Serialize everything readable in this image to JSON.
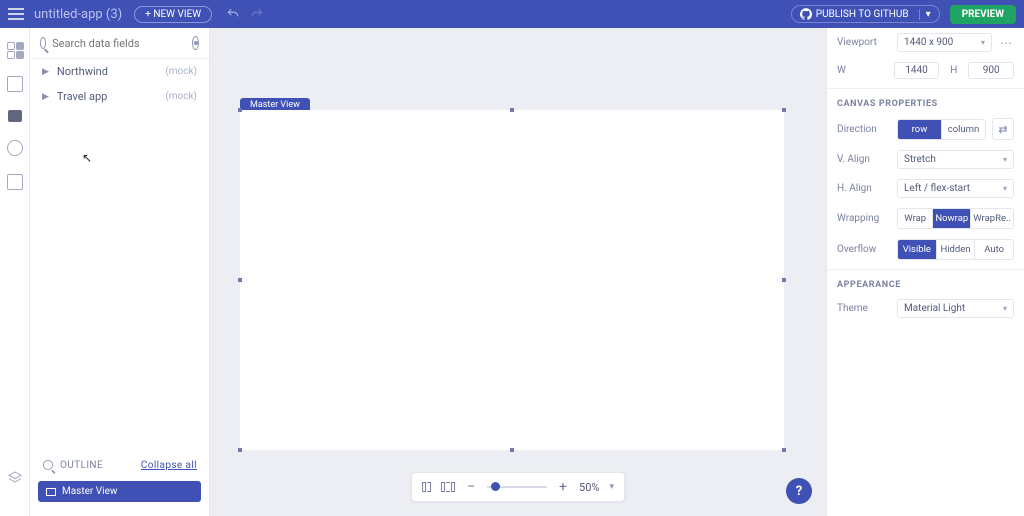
{
  "header": {
    "app_name": "untitled-app (3)",
    "new_view_label": "+ NEW VIEW",
    "publish_label": "PUBLISH TO GITHUB",
    "preview_label": "PREVIEW"
  },
  "left": {
    "search_placeholder": "Search data fields",
    "datasources": [
      {
        "name": "Northwind",
        "tag": "(mock)"
      },
      {
        "name": "Travel app",
        "tag": "(mock)"
      }
    ],
    "outline_label": "OUTLINE",
    "collapse_label": "Collapse all",
    "master_view_label": "Master View"
  },
  "canvas": {
    "view_label": "Master View",
    "zoom_pct": "50%"
  },
  "props": {
    "viewport": {
      "label": "Viewport",
      "value": "1440 x 900"
    },
    "width": {
      "label": "W",
      "value": "1440"
    },
    "height": {
      "label": "H",
      "value": "900"
    },
    "section_canvas": "CANVAS PROPERTIES",
    "direction": {
      "label": "Direction",
      "options": [
        "row",
        "column"
      ],
      "active": "row"
    },
    "valign": {
      "label": "V. Align",
      "value": "Stretch"
    },
    "halign": {
      "label": "H. Align",
      "value": "Left / flex-start"
    },
    "wrapping": {
      "label": "Wrapping",
      "options": [
        "Wrap",
        "Nowrap",
        "WrapRe.."
      ],
      "active": "Nowrap"
    },
    "overflow": {
      "label": "Overflow",
      "options": [
        "Visible",
        "Hidden",
        "Auto"
      ],
      "active": "Visible"
    },
    "section_appearance": "APPEARANCE",
    "theme": {
      "label": "Theme",
      "value": "Material Light"
    }
  }
}
